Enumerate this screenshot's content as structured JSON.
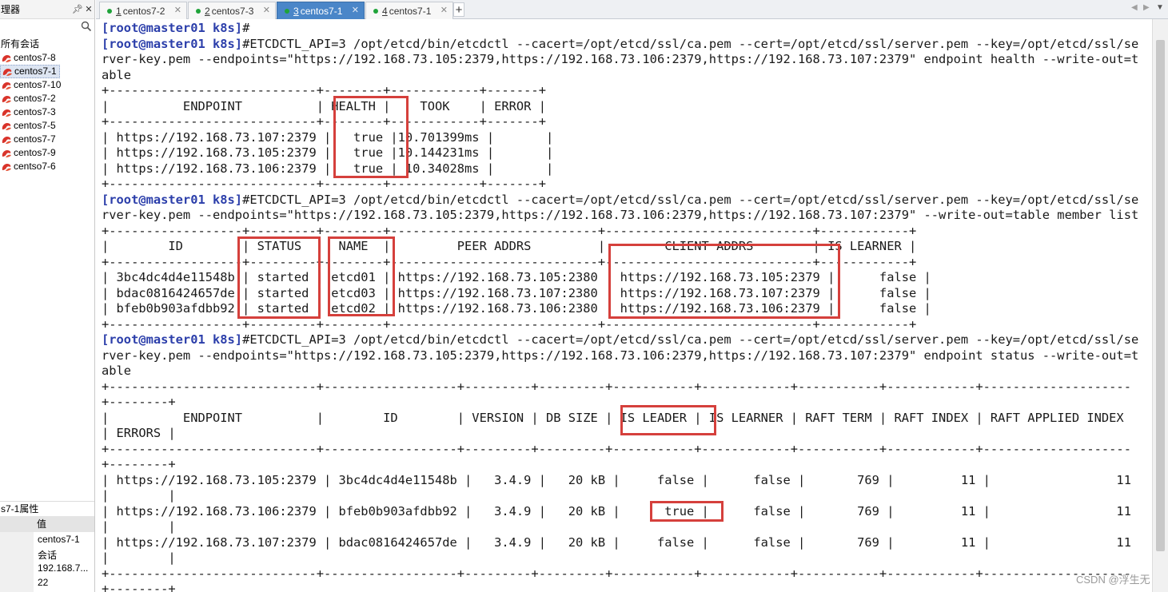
{
  "sidebar": {
    "title": "理器",
    "pin_icon": "pin-icon",
    "close_icon": "close-icon",
    "search_icon": "search-icon",
    "section_label": "所有会话",
    "sessions": [
      "centos7-8",
      "centos7-1",
      "centos7-10",
      "centos7-2",
      "centos7-3",
      "centos7-5",
      "centos7-7",
      "centos7-9",
      "centso7-6"
    ],
    "selected_session": "centos7-1",
    "properties": {
      "title": "s7-1属性",
      "value_header": "值",
      "values": [
        "centos7-1",
        "会话",
        "192.168.7...",
        "22"
      ]
    }
  },
  "tabs": [
    {
      "num": "1",
      "label": " centos7-2"
    },
    {
      "num": "2",
      "label": " centos7-3"
    },
    {
      "num": "3",
      "label": " centos7-1"
    },
    {
      "num": "4",
      "label": " centos7-1"
    }
  ],
  "active_tab_index": 2,
  "tab_add_label": "+",
  "terminal": {
    "lines": [
      {
        "prompt": "[root@master01 k8s]",
        "text": "#"
      },
      {
        "prompt": "[root@master01 k8s]",
        "text": "#ETCDCTL_API=3 /opt/etcd/bin/etcdctl --cacert=/opt/etcd/ssl/ca.pem --cert=/opt/etcd/ssl/server.pem --key=/opt/etcd/ssl/se"
      },
      {
        "prompt": "",
        "text": "rver-key.pem --endpoints=\"https://192.168.73.105:2379,https://192.168.73.106:2379,https://192.168.73.107:2379\" endpoint health --write-out=t"
      },
      {
        "prompt": "",
        "text": "able"
      },
      {
        "prompt": "",
        "text": "+----------------------------+--------+------------+-------+"
      },
      {
        "prompt": "",
        "text": "|          ENDPOINT          | HEALTH |    TOOK    | ERROR |"
      },
      {
        "prompt": "",
        "text": "+----------------------------+--------+------------+-------+"
      },
      {
        "prompt": "",
        "text": "| https://192.168.73.107:2379 |   true |10.701399ms |       |"
      },
      {
        "prompt": "",
        "text": "| https://192.168.73.105:2379 |   true |10.144231ms |       |"
      },
      {
        "prompt": "",
        "text": "| https://192.168.73.106:2379 |   true | 10.34028ms |       |"
      },
      {
        "prompt": "",
        "text": "+----------------------------+--------+------------+-------+"
      },
      {
        "prompt": "[root@master01 k8s]",
        "text": "#ETCDCTL_API=3 /opt/etcd/bin/etcdctl --cacert=/opt/etcd/ssl/ca.pem --cert=/opt/etcd/ssl/server.pem --key=/opt/etcd/ssl/se"
      },
      {
        "prompt": "",
        "text": "rver-key.pem --endpoints=\"https://192.168.73.105:2379,https://192.168.73.106:2379,https://192.168.73.107:2379\" --write-out=table member list"
      },
      {
        "prompt": "",
        "text": "+------------------+---------+--------+----------------------------+----------------------------+------------+"
      },
      {
        "prompt": "",
        "text": "|        ID        | STATUS  |  NAME  |         PEER ADDRS         |        CLIENT ADDRS        | IS LEARNER |"
      },
      {
        "prompt": "",
        "text": "+------------------+---------+--------+----------------------------+----------------------------+------------+"
      },
      {
        "prompt": "",
        "text": "| 3bc4dc4d4e11548b | started | etcd01 | https://192.168.73.105:2380 | https://192.168.73.105:2379 |      false |"
      },
      {
        "prompt": "",
        "text": "| bdac0816424657de | started | etcd03 | https://192.168.73.107:2380 | https://192.168.73.107:2379 |      false |"
      },
      {
        "prompt": "",
        "text": "| bfeb0b903afdbb92 | started | etcd02 | https://192.168.73.106:2380 | https://192.168.73.106:2379 |      false |"
      },
      {
        "prompt": "",
        "text": "+------------------+---------+--------+----------------------------+----------------------------+------------+"
      },
      {
        "prompt": "[root@master01 k8s]",
        "text": "#ETCDCTL_API=3 /opt/etcd/bin/etcdctl --cacert=/opt/etcd/ssl/ca.pem --cert=/opt/etcd/ssl/server.pem --key=/opt/etcd/ssl/se"
      },
      {
        "prompt": "",
        "text": "rver-key.pem --endpoints=\"https://192.168.73.105:2379,https://192.168.73.106:2379,https://192.168.73.107:2379\" endpoint status --write-out=t"
      },
      {
        "prompt": "",
        "text": "able"
      },
      {
        "prompt": "",
        "text": "+----------------------------+------------------+---------+---------+-----------+------------+-----------+------------+--------------------"
      },
      {
        "prompt": "",
        "text": "+--------+"
      },
      {
        "prompt": "",
        "text": "|          ENDPOINT          |        ID        | VERSION | DB SIZE | IS LEADER | IS LEARNER | RAFT TERM | RAFT INDEX | RAFT APPLIED INDEX"
      },
      {
        "prompt": "",
        "text": "| ERRORS |"
      },
      {
        "prompt": "",
        "text": "+----------------------------+------------------+---------+---------+-----------+------------+-----------+------------+--------------------"
      },
      {
        "prompt": "",
        "text": "+--------+"
      },
      {
        "prompt": "",
        "text": "| https://192.168.73.105:2379 | 3bc4dc4d4e11548b |   3.4.9 |   20 kB |     false |      false |       769 |         11 |                 11"
      },
      {
        "prompt": "",
        "text": "|        |"
      },
      {
        "prompt": "",
        "text": "| https://192.168.73.106:2379 | bfeb0b903afdbb92 |   3.4.9 |   20 kB |      true |      false |       769 |         11 |                 11"
      },
      {
        "prompt": "",
        "text": "|        |"
      },
      {
        "prompt": "",
        "text": "| https://192.168.73.107:2379 | bdac0816424657de |   3.4.9 |   20 kB |     false |      false |       769 |         11 |                 11"
      },
      {
        "prompt": "",
        "text": "|        |"
      },
      {
        "prompt": "",
        "text": "+----------------------------+------------------+---------+---------+-----------+------------+-----------+------------+--------------------"
      },
      {
        "prompt": "",
        "text": "+--------+"
      }
    ]
  },
  "highlight_color": "#d5403c",
  "prompt_color": "#2b3eaa",
  "active_tab_color": "#4a86c8",
  "watermark": "CSDN @浮生无"
}
